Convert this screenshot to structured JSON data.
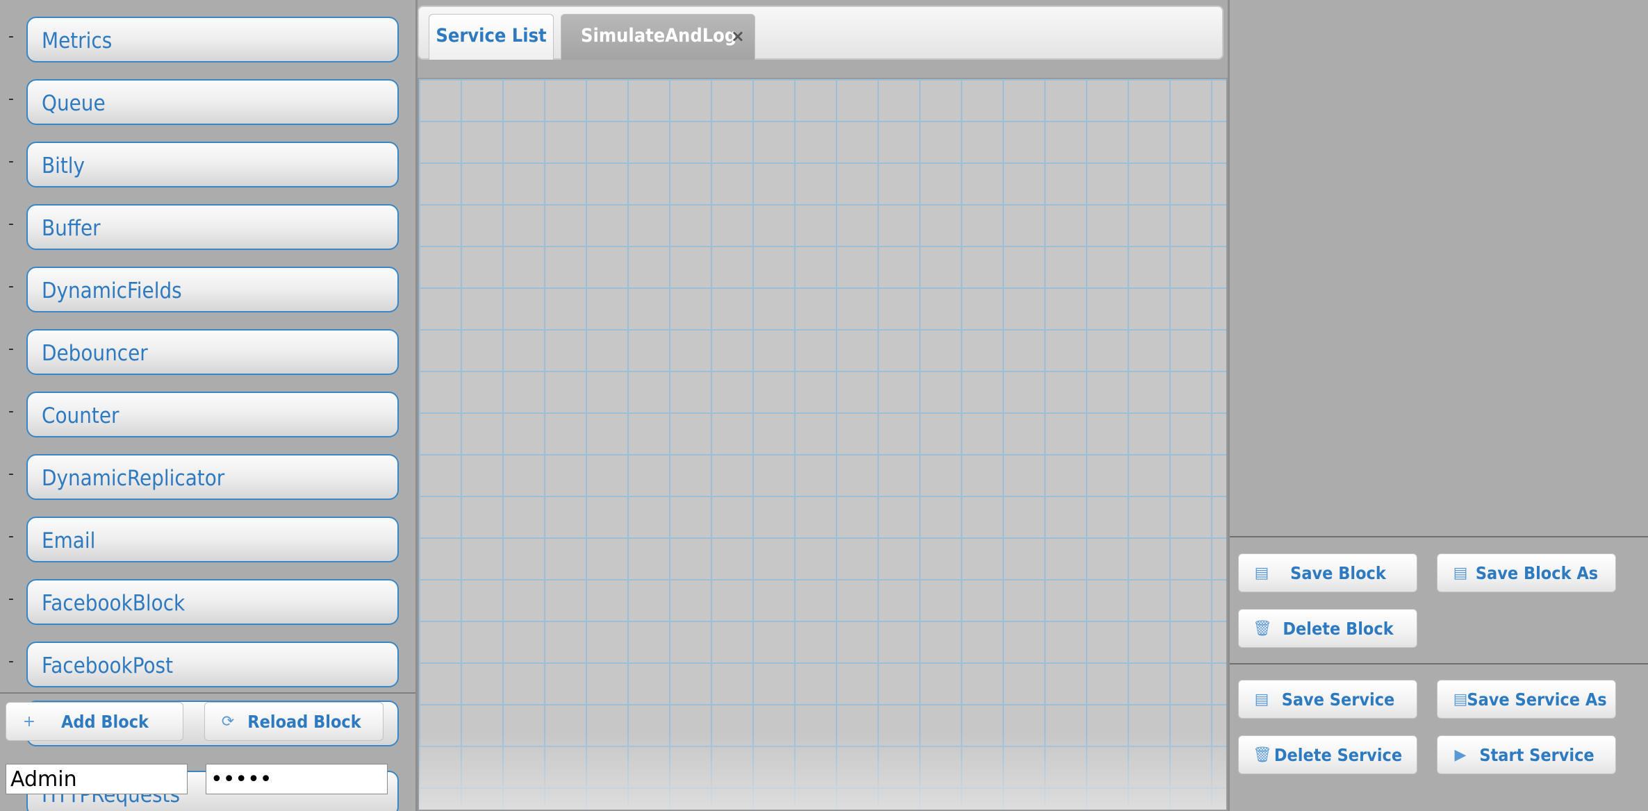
{
  "blocks": [
    {
      "label": "Metrics"
    },
    {
      "label": "Queue"
    },
    {
      "label": "Bitly"
    },
    {
      "label": "Buffer"
    },
    {
      "label": "DynamicFields"
    },
    {
      "label": "Debouncer"
    },
    {
      "label": "Counter"
    },
    {
      "label": "DynamicReplicator"
    },
    {
      "label": "Email"
    },
    {
      "label": "FacebookBlock"
    },
    {
      "label": "FacebookPost"
    }
  ],
  "hidden_block_label": "HTTPRequests",
  "block_dash": "-",
  "left_actions": {
    "add_block": {
      "label": "Add Block",
      "icon": "plus-icon",
      "glyph": "+"
    },
    "reload_block": {
      "label": "Reload Block",
      "icon": "reload-icon",
      "glyph": "⟳"
    }
  },
  "credentials": {
    "username": "Admin",
    "password": "•••••"
  },
  "tabs": {
    "service_list": "Service List",
    "active": "SimulateAndLog",
    "close_glyph": "×"
  },
  "block_actions": {
    "save_block": {
      "label": "Save Block",
      "icon": "save-icon",
      "glyph": "▤"
    },
    "save_block_as": {
      "label": "Save Block As",
      "icon": "save-icon",
      "glyph": "▤"
    },
    "delete_block": {
      "label": "Delete Block",
      "icon": "trash-icon",
      "glyph": "🗑"
    }
  },
  "service_actions": {
    "save_service": {
      "label": "Save Service",
      "icon": "save-icon",
      "glyph": "▤"
    },
    "save_service_as": {
      "label": "Save Service As",
      "icon": "save-icon",
      "glyph": "▤"
    },
    "delete_service": {
      "label": "Delete Service",
      "icon": "trash-icon",
      "glyph": "🗑"
    },
    "start_service": {
      "label": "Start Service",
      "icon": "play-icon",
      "glyph": "▶"
    }
  },
  "colors": {
    "accent": "#2e7ac0",
    "block_border": "#3a86c4",
    "grid_line": "#9cbfd8",
    "panel_bg": "#acacac"
  }
}
